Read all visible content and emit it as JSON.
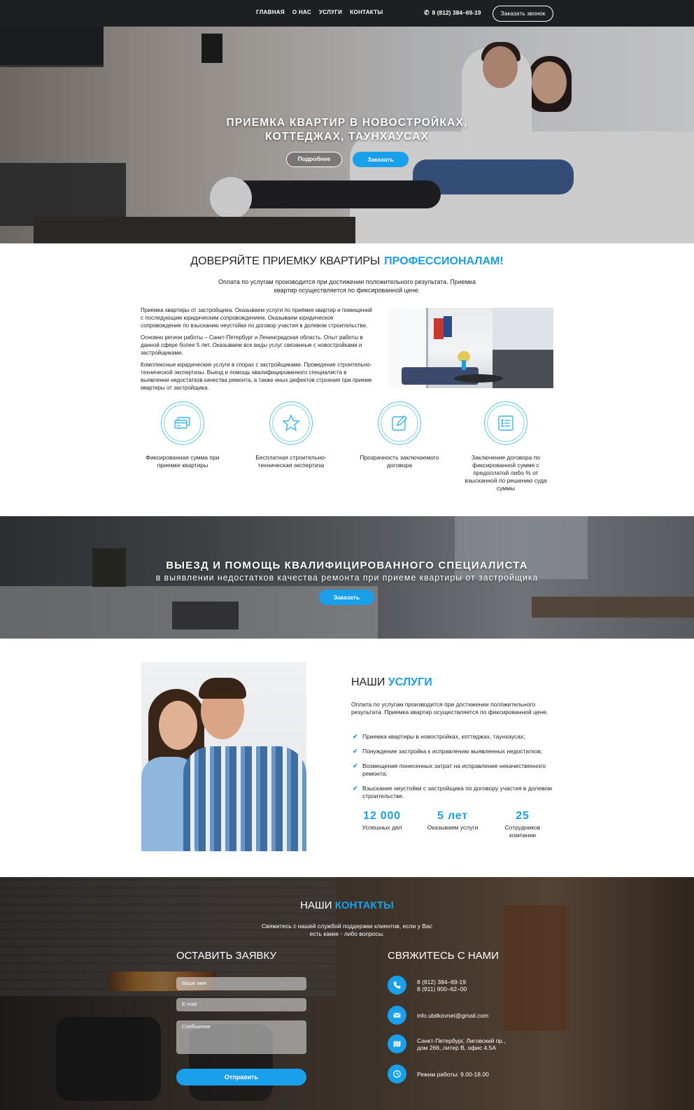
{
  "header": {
    "nav": [
      "ГЛАВНАЯ",
      "О НАС",
      "УСЛУГИ",
      "КОНТАКТЫ"
    ],
    "phone": "8 (812) 384–69-19",
    "call_button": "Заказать звонок"
  },
  "hero": {
    "title_line1": "ПРИЕМКА КВАРТИР В НОВОСТРОЙКАХ,",
    "title_line2": "КОТТЕДЖАХ, ТАУНХАУСАХ",
    "more_button": "Подробнее",
    "order_button": "Заказать"
  },
  "trust": {
    "title_main": "ДОВЕРЯЙТЕ ПРИЕМКУ КВАРТИРЫ",
    "title_accent": "ПРОФЕССИОНАЛАМ!",
    "subtitle": "Оплата по услугам производится при достижении положительного результата. Приемка квартир осуществляется по фиксированной цене.",
    "paragraphs": [
      "Приемка квартиры от застройщика. Оказываем услуги по приёмке квартир и помещений с последующим юридическим сопровождением. Оказываем юридическое сопровождение по взысканию неустойки по договор участия в долевом строительстве.",
      "Основно регион работы – Санкт-Петербург и Ленинградская область. Опыт работы в данной сфере более 5 лет. Оказываем все виды услуг связанные с новостройками и застройщиками.",
      "Комплексные юридические услуги в спорах с застройщиками. Проведение строительно-технической экспертизы. Выезд и помощь квалифицированного специалиста в выявлении недостатков качества ремонта, а также иных дефектов строения при приеме квартиры от застройщика."
    ],
    "features": [
      {
        "icon": "credit-card-icon",
        "label": "Фиксированная сумма при приемке квартиры"
      },
      {
        "icon": "star-icon",
        "label": "Бесплатная строительно-техническая экспертиза"
      },
      {
        "icon": "edit-icon",
        "label": "Прозрачность заключаемого договора"
      },
      {
        "icon": "list-icon",
        "label": "Заключение договора по фиксированной сумме с предоплатой либо % от взысканной по решению суда суммы"
      }
    ]
  },
  "banner": {
    "title": "ВЫЕЗД И ПОМОЩЬ КВАЛИФИЦИРОВАННОГО СПЕЦИАЛИСТА",
    "subtitle": "в выявлении недостатков качества ремонта при приеме квартиры от застройщика",
    "button": "Заказать"
  },
  "services": {
    "title_main": "НАШИ",
    "title_accent": "УСЛУГИ",
    "subtitle": "Оплата по услугам производится при достижении положительного результата. Приемка квартир осуществляется по фиксированной цене.",
    "items": [
      "Приемка квартиры в новостройках, коттеджах, таунхаусах;",
      "Понуждение застройка к исправлению выявленных недостатков;",
      "Возмещение понесенных затрат на исправление некачественного ремонта;",
      "Взыскание неустойки с застройщика по договору участия в долевом строительстве."
    ],
    "stats": [
      {
        "value": "12 000",
        "label": "Успешных дел"
      },
      {
        "value": "5 лет",
        "label": "Оказываем услуги"
      },
      {
        "value": "25",
        "label": "Сотрудников компании"
      }
    ]
  },
  "contacts": {
    "title_main": "НАШИ",
    "title_accent": "КОНТАКТЫ",
    "subtitle": "Свяжитесь с нашей службой поддержки клиентов, если у Вас есть какие - либо вопросы.",
    "form": {
      "title": "ОСТАВИТЬ ЗАЯВКУ",
      "name_placeholder": "Ваше имя",
      "email_placeholder": "E-mail",
      "message_placeholder": "Сообщение",
      "submit": "Отправить"
    },
    "info": {
      "title": "СВЯЖИТЕСЬ С НАМИ",
      "phone1": "8 (812) 384–69-19",
      "phone2": "8 (911) 900–62–00",
      "email": "info.ubitkovnet@gmail.com",
      "address1": "Санкт-Петербург, Лиговский пр.,",
      "address2": "дом 266, литер В, офис 4.5А",
      "hours": "Режим работы: 9.00-18.00"
    }
  },
  "colors": {
    "accent": "#1aa0ea",
    "header_bg": "#1e1f22"
  }
}
